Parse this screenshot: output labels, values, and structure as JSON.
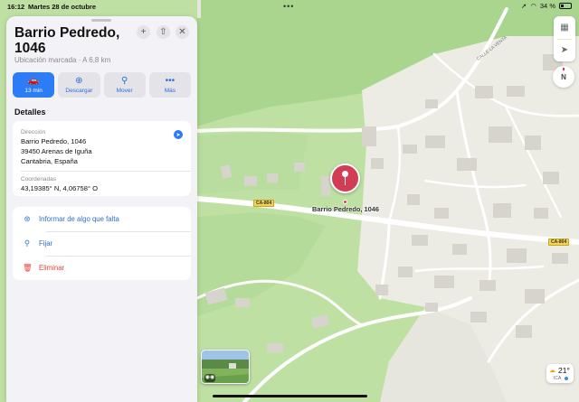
{
  "status_bar": {
    "time": "16:12",
    "date": "Martes 28 de octubre",
    "multitask_dots": "•••",
    "battery": "34 %",
    "battery_level": 0.34
  },
  "place": {
    "title": "Barrio Pedredo, 1046",
    "subtitle": "Ubicación marcada · A 6,8 km"
  },
  "header_buttons": [
    {
      "name": "add-button",
      "icon": "plus-icon",
      "glyph": "+"
    },
    {
      "name": "share-button",
      "icon": "share-icon",
      "glyph": "⇧"
    },
    {
      "name": "close-button",
      "icon": "close-icon",
      "glyph": "✕"
    }
  ],
  "actions": [
    {
      "name": "directions-button",
      "icon": "car-icon",
      "glyph": "🚗",
      "label": "13 min",
      "primary": true
    },
    {
      "name": "download-button",
      "icon": "download-icon",
      "glyph": "⊕",
      "label": "Descargar",
      "primary": false
    },
    {
      "name": "move-button",
      "icon": "move-pin-icon",
      "glyph": "⚲",
      "label": "Mover",
      "primary": false
    },
    {
      "name": "more-button",
      "icon": "ellipsis-icon",
      "glyph": "•••",
      "label": "Más",
      "primary": false
    }
  ],
  "details": {
    "section_title": "Detalles",
    "address_label": "Dirección",
    "address_line1": "Barrio Pedredo, 1046",
    "address_line2": "39450 Arenas de Iguña",
    "address_line3": "Cantabria, España",
    "coords_label": "Coordenadas",
    "coords_value": "43,19385° N, 4,06758° O"
  },
  "options": [
    {
      "name": "report-issue-row",
      "icon": "report-icon",
      "glyph": "⊛",
      "label": "Informar de algo que falta",
      "color": "blue"
    },
    {
      "name": "pin-row",
      "icon": "pin-icon",
      "glyph": "⚲",
      "label": "Fijar",
      "color": "blue"
    },
    {
      "name": "delete-row",
      "icon": "trash-icon",
      "glyph": "🗑",
      "label": "Eliminar",
      "color": "red"
    }
  ],
  "map": {
    "pin_label": "Barrio Pedredo, 1046",
    "road_labels": [
      "CA-804",
      "CA-804"
    ],
    "street_name": "CALLE LA VENTA",
    "compass_letter": "N",
    "weather_temp": "21°",
    "weather_index": "ICA"
  },
  "colors": {
    "accent": "#2c7cf6",
    "pin": "#d33c55",
    "delete": "#e5453b",
    "map_green": "#bfe0a3",
    "village": "#ecebe4"
  }
}
